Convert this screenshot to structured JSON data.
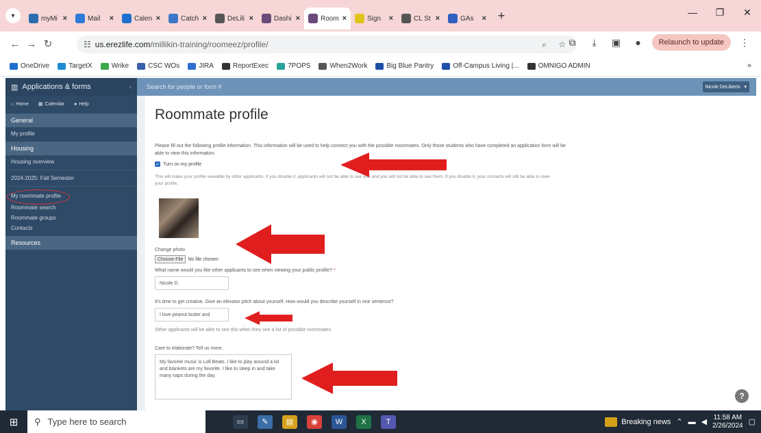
{
  "browser": {
    "tabs": [
      {
        "label": "myMi",
        "color": "#2b6cb0"
      },
      {
        "label": "Mail",
        "color": "#2f7ad9"
      },
      {
        "label": "Calen",
        "color": "#1f6fd1"
      },
      {
        "label": "Catch",
        "color": "#3b77c8"
      },
      {
        "label": "DeLili",
        "color": "#555555"
      },
      {
        "label": "Dashi",
        "color": "#6a4a7a"
      },
      {
        "label": "Room",
        "color": "#6a4a7a",
        "active": true
      },
      {
        "label": "Sign",
        "color": "#e0c419"
      },
      {
        "label": "CL St",
        "color": "#555555"
      },
      {
        "label": "GAs",
        "color": "#2f5fbf"
      }
    ],
    "url_host": "us.erezlife.com",
    "url_path": "/millikin-training/roomeez/profile/",
    "relaunch_label": "Relaunch to update",
    "bookmarks": [
      {
        "label": "OneDrive",
        "color": "#1e6fd1"
      },
      {
        "label": "TargetX",
        "color": "#1e8ad1"
      },
      {
        "label": "Wrike",
        "color": "#3aa84b"
      },
      {
        "label": "CSC WOs",
        "color": "#3b5fa8"
      },
      {
        "label": "JIRA",
        "color": "#2f6fd1"
      },
      {
        "label": "ReportExec",
        "color": "#333333"
      },
      {
        "label": "7POPS",
        "color": "#2aa39a"
      },
      {
        "label": "When2Work",
        "color": "#555555"
      },
      {
        "label": "Big Blue Pantry",
        "color": "#1f4fa8"
      },
      {
        "label": "Off-Campus Living |...",
        "color": "#1f4fa8"
      },
      {
        "label": "OMNIGO ADMIN",
        "color": "#333333"
      }
    ]
  },
  "sidebar": {
    "title": "Applications & forms",
    "sub_links": [
      "Home",
      "Calendar",
      "Help"
    ],
    "general_header": "General",
    "my_profile": "My profile",
    "housing_header": "Housing",
    "housing_overview": "Housing overview",
    "semester": "2024-2025: Fall Semester",
    "roommate_profile": "My roommate profile",
    "roommate_search": "Roommate search",
    "roommate_groups": "Roommate groups",
    "contacts": "Contacts",
    "resources_header": "Resources"
  },
  "topstrip": {
    "search_placeholder": "Search for people or form #",
    "user_name": "Nicole DeLiberis"
  },
  "page": {
    "title": "Roommate profile",
    "intro": "Please fill out the following profile information. This information will be used to help connect you with the possible roommates. Only those students who have completed an application form will be able to view this information.",
    "checkbox_label": "Turn on my profile",
    "checkbox_help": "This will make your profile viewable by other applicants. If you disable it, applicants will not be able to see you and you will not be able to see them. If you disable it, your contacts will still be able to view your profile.",
    "change_photo_label": "Change photo",
    "choose_file": "Choose File",
    "no_file": "No file chosen",
    "name_question": "What name would you like other applicants to see when viewing your public profile?",
    "required_mark": "*",
    "name_value": "Nicole D.",
    "pitch_question": "It's time to get creative. Give an elevator pitch about yourself. How would you describe yourself in one sentence?",
    "pitch_value": "I love peanut butter and",
    "pitch_help": "Other applicants will be able to see this when they see a list of possible roommates.",
    "elaborate_question": "Care to elaborate? Tell us more.",
    "elaborate_value": "My favorite music is Lofi Beats. I like to play around a lot and blankets are my favorite. I like to sleep in and take many naps during the day."
  },
  "taskbar": {
    "search_placeholder": "Type here to search",
    "news": "Breaking news",
    "time": "11:58 AM",
    "date": "2/26/2024"
  },
  "colors": {
    "sidebar_bg": "#2f4a66",
    "accent": "#6d93b8",
    "arrow": "#e01e1e"
  }
}
